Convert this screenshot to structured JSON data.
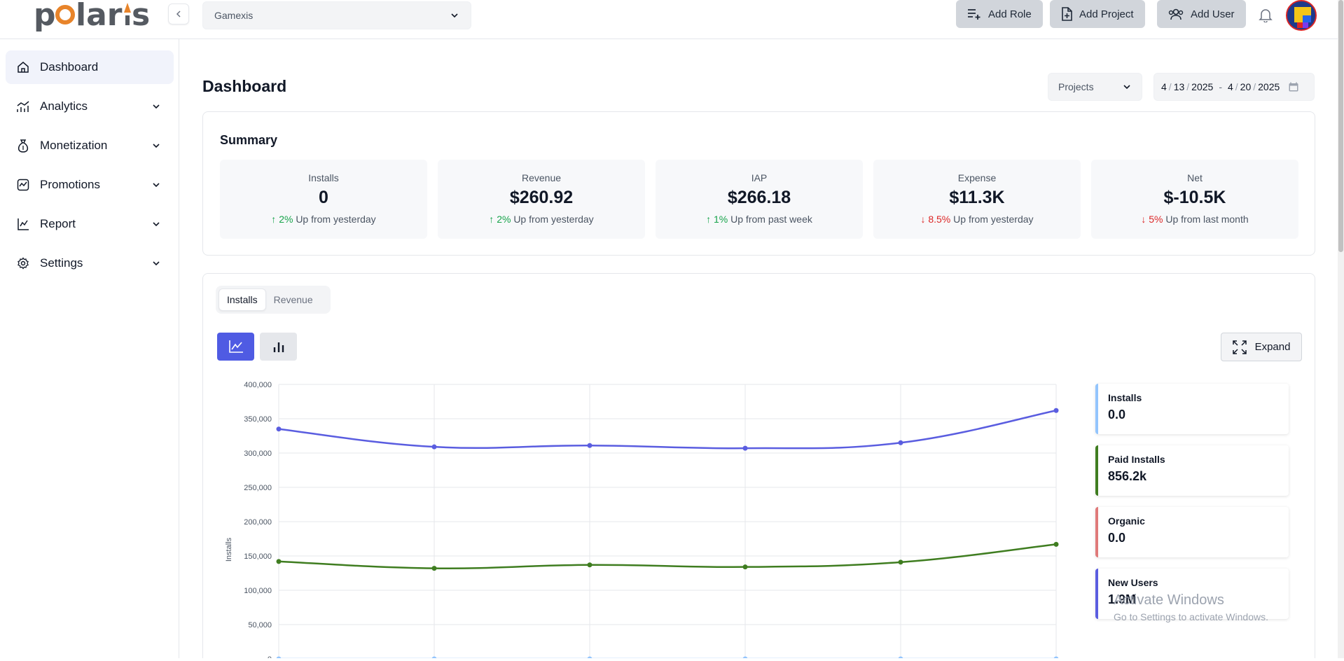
{
  "app": {
    "logo_text": "polaris"
  },
  "header": {
    "project_select": "Gamexis",
    "buttons": [
      {
        "label": "Add Role",
        "icon": "list-plus-icon"
      },
      {
        "label": "Add Project",
        "icon": "file-plus-icon"
      },
      {
        "label": "Add User",
        "icon": "users-icon"
      }
    ]
  },
  "sidebar": {
    "items": [
      {
        "label": "Dashboard",
        "icon": "home-icon",
        "active": true
      },
      {
        "label": "Analytics",
        "icon": "chart-icon"
      },
      {
        "label": "Monetization",
        "icon": "money-bag-icon"
      },
      {
        "label": "Promotions",
        "icon": "trend-icon"
      },
      {
        "label": "Report",
        "icon": "report-icon"
      },
      {
        "label": "Settings",
        "icon": "gear-icon"
      }
    ]
  },
  "main": {
    "title": "Dashboard",
    "filter_select": "Projects",
    "date_range": {
      "start_m": "4",
      "start_d": "13",
      "start_y": "2025",
      "end_m": "4",
      "end_d": "20",
      "end_y": "2025"
    },
    "summary": {
      "title": "Summary",
      "stats": [
        {
          "label": "Installs",
          "value": "0",
          "change": "2%",
          "direction": "up",
          "note": "Up from yesterday"
        },
        {
          "label": "Revenue",
          "value": "$260.92",
          "change": "2%",
          "direction": "up",
          "note": "Up from yesterday"
        },
        {
          "label": "IAP",
          "value": "$266.18",
          "change": "1%",
          "direction": "up",
          "note": "Up from past week"
        },
        {
          "label": "Expense",
          "value": "$11.3K",
          "change": "8.5%",
          "direction": "down",
          "note": "Up from yesterday"
        },
        {
          "label": "Net",
          "value": "$-10.5K",
          "change": "5%",
          "direction": "down",
          "note": "Up from last month"
        }
      ]
    },
    "chart_panel": {
      "tabs": [
        "Installs",
        "Revenue"
      ],
      "active_tab": "Installs",
      "expand_label": "Expand",
      "legend": [
        {
          "name": "Installs",
          "value": "0.0",
          "color": "#93c5fd"
        },
        {
          "name": "Paid Installs",
          "value": "856.2k",
          "color": "#3f7d20"
        },
        {
          "name": "Organic",
          "value": "0.0",
          "color": "#e07a7a"
        },
        {
          "name": "New Users",
          "value": "1.9M",
          "color": "#5a5de0"
        }
      ]
    }
  },
  "chart_data": {
    "type": "line",
    "ylabel": "Installs",
    "ylim": [
      0,
      400000
    ],
    "yticks": [
      "0",
      "50,000",
      "100,000",
      "150,000",
      "200,000",
      "250,000",
      "300,000",
      "350,000",
      "400,000"
    ],
    "x": [
      1,
      2,
      3,
      4,
      5,
      6
    ],
    "series": [
      {
        "name": "New Users",
        "color": "#5a5de0",
        "values": [
          335000,
          309000,
          311000,
          307000,
          315000,
          362000
        ]
      },
      {
        "name": "Paid Installs",
        "color": "#3f7d20",
        "values": [
          142000,
          132000,
          137000,
          134000,
          141000,
          167000
        ]
      },
      {
        "name": "Installs",
        "color": "#93c5fd",
        "values": [
          0,
          0,
          0,
          0,
          0,
          0
        ]
      }
    ],
    "grid": true
  },
  "watermark": {
    "line1": "Activate Windows",
    "line2": "Go to Settings to activate Windows."
  }
}
